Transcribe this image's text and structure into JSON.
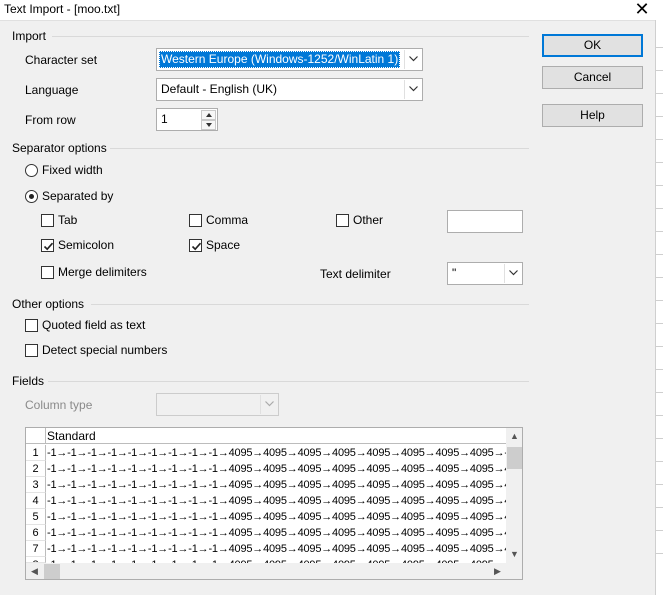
{
  "window": {
    "title": "Text Import - [moo.txt]",
    "close_glyph": "✕"
  },
  "import": {
    "section": "Import",
    "charset_label": "Character set",
    "charset_value": "Western Europe (Windows-1252/WinLatin 1)",
    "language_label": "Language",
    "language_value": "Default - English (UK)",
    "from_row_label": "From row",
    "from_row_value": "1"
  },
  "separator": {
    "section": "Separator options",
    "fixed_width": {
      "label": "Fixed width",
      "selected": false
    },
    "separated_by": {
      "label": "Separated by",
      "selected": true
    },
    "tab": {
      "label": "Tab",
      "checked": false
    },
    "comma": {
      "label": "Comma",
      "checked": false
    },
    "other": {
      "label": "Other",
      "checked": false,
      "value": ""
    },
    "semicolon": {
      "label": "Semicolon",
      "checked": true
    },
    "space": {
      "label": "Space",
      "checked": true
    },
    "merge": {
      "label": "Merge delimiters",
      "checked": false
    },
    "text_delimiter_label": "Text delimiter",
    "text_delimiter_value": "\""
  },
  "other_options": {
    "section": "Other options",
    "quoted": {
      "label": "Quoted field as text",
      "checked": false
    },
    "detect": {
      "label": "Detect special numbers",
      "checked": false
    }
  },
  "fields": {
    "section": "Fields",
    "column_type_label": "Column type",
    "column_type_value": "",
    "grid": {
      "column_header": "Standard",
      "rows": [
        {
          "num": "1",
          "text": "-1→-1→-1→-1→-1→-1→-1→-1→-1→4095→4095→4095→4095→4095→4095→4095→4095→-1"
        },
        {
          "num": "2",
          "text": "-1→-1→-1→-1→-1→-1→-1→-1→-1→4095→4095→4095→4095→4095→4095→4095→4095→40"
        },
        {
          "num": "3",
          "text": "-1→-1→-1→-1→-1→-1→-1→-1→-1→4095→4095→4095→4095→4095→4095→4095→4095→40"
        },
        {
          "num": "4",
          "text": "-1→-1→-1→-1→-1→-1→-1→-1→-1→4095→4095→4095→4095→4095→4095→4095→4095→40"
        },
        {
          "num": "5",
          "text": "-1→-1→-1→-1→-1→-1→-1→-1→-1→4095→4095→4095→4095→4095→4095→4095→4095→40"
        },
        {
          "num": "6",
          "text": "-1→-1→-1→-1→-1→-1→-1→-1→-1→4095→4095→4095→4095→4095→4095→4095→4095→40"
        },
        {
          "num": "7",
          "text": "-1→-1→-1→-1→-1→-1→-1→-1→-1→4095→4095→4095→4095→4095→4095→4095→4095→40"
        },
        {
          "num": "8",
          "text": "-1→-1→-1→-1→-1→-1→-1→-1→-1→4095→4095→4095→4095→4095→4095→4095→4095→40"
        }
      ]
    }
  },
  "buttons": {
    "ok": "OK",
    "cancel": "Cancel",
    "help": "Help"
  },
  "colors": {
    "accent": "#0078d7",
    "dialog_bg": "#f0f0f0"
  }
}
